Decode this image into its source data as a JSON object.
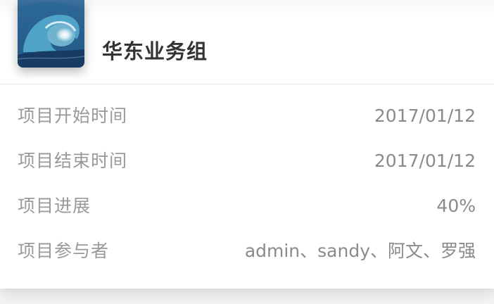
{
  "header": {
    "title": "华东业务组",
    "avatar_icon": "ocean-wave-image"
  },
  "details": [
    {
      "label": "项目开始时间",
      "value": "2017/01/12"
    },
    {
      "label": "项目结束时间",
      "value": "2017/01/12"
    },
    {
      "label": "项目进展",
      "value": "40%"
    },
    {
      "label": "项目参与者",
      "value": "admin、sandy、阿文、罗强"
    }
  ],
  "colors": {
    "title": "#333333",
    "label": "#999999",
    "value": "#8a8a8a",
    "divider": "#e6e6e6",
    "background": "#ffffff"
  }
}
